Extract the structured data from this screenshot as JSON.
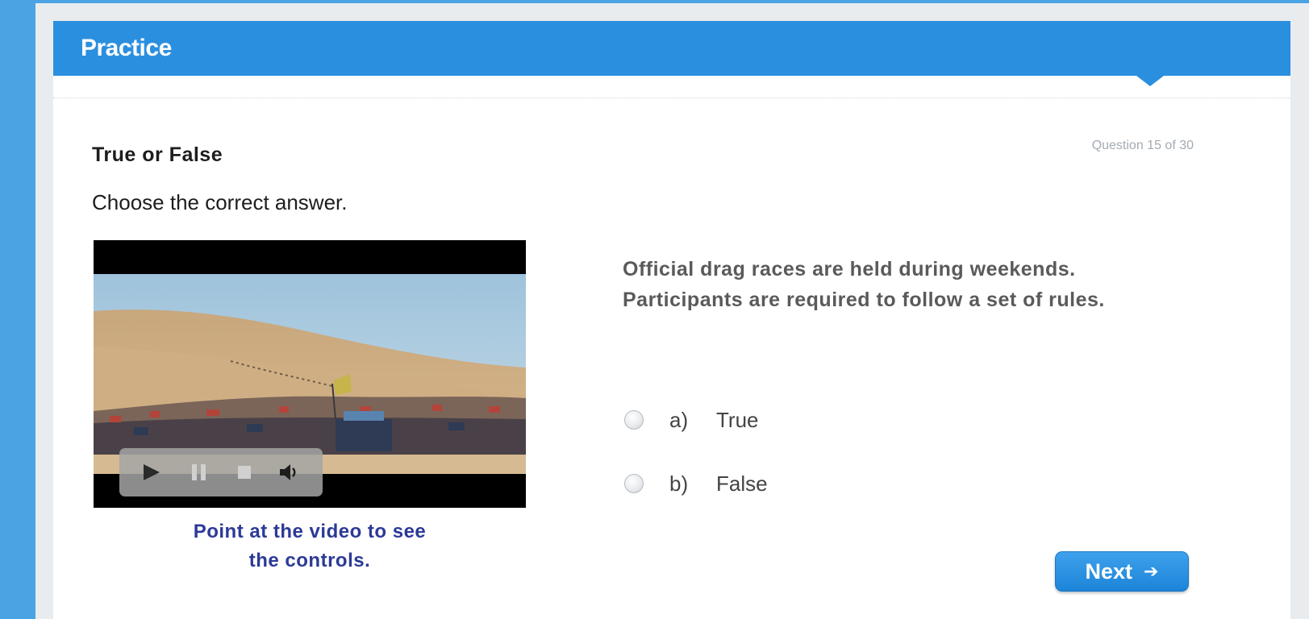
{
  "header": {
    "title": "Practice"
  },
  "question": {
    "type_label": "True or False",
    "counter": "Question 15 of 30",
    "instruction": "Choose the correct answer.",
    "statement_line1": "Official drag races are held during weekends.",
    "statement_line2": "Participants are required to follow a set of rules."
  },
  "video": {
    "caption_line1": "Point at the video to see",
    "caption_line2": "the controls.",
    "controls": [
      "play-icon",
      "pause-icon",
      "stop-icon",
      "volume-icon"
    ]
  },
  "options": [
    {
      "letter": "a)",
      "text": "True",
      "selected": false
    },
    {
      "letter": "b)",
      "text": "False",
      "selected": false
    }
  ],
  "navigation": {
    "next_label": "Next",
    "next_icon": "arrow-right-icon"
  },
  "colors": {
    "background": "#4aa3e3",
    "header": "#2b8fe0",
    "caption": "#2c3a96",
    "button": "#1c84d8"
  }
}
